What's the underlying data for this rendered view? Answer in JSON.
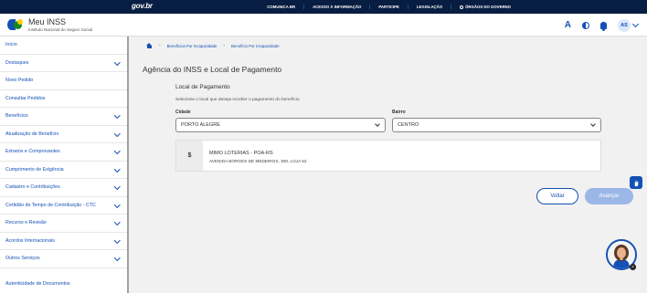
{
  "govbar": {
    "logo": "gov.br",
    "links": [
      "COMUNICA BR",
      "ACESSO À INFORMAÇÃO",
      "PARTICIPE",
      "LEGISLAÇÃO",
      "ÓRGÃOS DO GOVERNO"
    ]
  },
  "header": {
    "app_title": "Meu INSS",
    "app_subtitle": "Instituto Nacional do Seguro Social",
    "font_size_label": "A",
    "avatar_initials": "AS"
  },
  "sidebar": {
    "items": [
      {
        "label": "Início",
        "has_chevron": false
      },
      {
        "label": "Destaques",
        "has_chevron": true
      },
      {
        "label": "Novo Pedido",
        "has_chevron": false
      },
      {
        "label": "Consultar Pedidos",
        "has_chevron": false
      },
      {
        "label": "Benefícios",
        "has_chevron": true
      },
      {
        "label": "Atualização de Benefício",
        "has_chevron": true
      },
      {
        "label": "Extratos e Comprovantes",
        "has_chevron": true
      },
      {
        "label": "Cumprimento de Exigência",
        "has_chevron": true
      },
      {
        "label": "Cadastro e Contribuições",
        "has_chevron": true
      },
      {
        "label": "Certidão de Tempo de Contribuição - CTC",
        "has_chevron": true
      },
      {
        "label": "Recurso e Revisão",
        "has_chevron": true
      },
      {
        "label": "Acordos Internacionais",
        "has_chevron": true
      },
      {
        "label": "Outros Serviços",
        "has_chevron": true
      },
      {
        "label": "Autenticidade de Documentos",
        "has_chevron": false
      }
    ]
  },
  "breadcrumb": {
    "items": [
      "Benefícios Por Incapacidade",
      "Benefício Por Incapacidade"
    ]
  },
  "page": {
    "title": "Agência do INSS e Local de Pagamento",
    "section_title": "Local de Pagamento",
    "section_description": "Selecione o local que deseja receber o pagamento do benefício."
  },
  "form": {
    "cidade_label": "Cidade",
    "cidade_value": "PORTO ALEGRE",
    "bairro_label": "Bairro",
    "bairro_value": "CENTRO"
  },
  "payment_location": {
    "icon": "$",
    "name": "MIMO LOTERIAS - POA-RS",
    "address": "AVENIDA BORGES DE MEDEIROS, 308, LOJA 52"
  },
  "buttons": {
    "back": "Voltar",
    "next": "Avançar"
  },
  "colors": {
    "govbar": "#071d41",
    "primary": "#1351b4",
    "disabled_button": "#9bb7e6"
  }
}
